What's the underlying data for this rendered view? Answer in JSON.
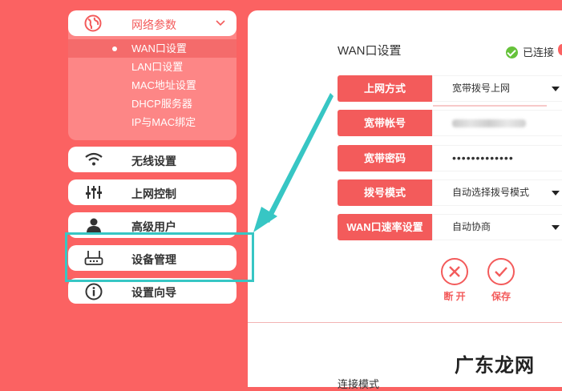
{
  "sidebar": {
    "group": {
      "label": "网络参数",
      "items": [
        {
          "label": "WAN口设置",
          "active": true
        },
        {
          "label": "LAN口设置"
        },
        {
          "label": "MAC地址设置"
        },
        {
          "label": "DHCP服务器"
        },
        {
          "label": "IP与MAC绑定"
        }
      ]
    },
    "menu": [
      {
        "label": "无线设置",
        "icon": "wifi-icon"
      },
      {
        "label": "上网控制",
        "icon": "sliders-icon"
      },
      {
        "label": "高级用户",
        "icon": "user-icon"
      },
      {
        "label": "设备管理",
        "icon": "router-icon"
      },
      {
        "label": "设置向导",
        "icon": "info-icon"
      }
    ]
  },
  "main": {
    "title": "WAN口设置",
    "status": "已连接",
    "fields": [
      {
        "label": "上网方式",
        "value": "宽带拨号上网",
        "type": "select"
      },
      {
        "label": "宽带帐号",
        "value": "",
        "type": "text-blurred"
      },
      {
        "label": "宽带密码",
        "value": "•••••••••••••",
        "type": "password"
      },
      {
        "label": "拨号模式",
        "value": "自动选择拨号模式",
        "type": "select"
      },
      {
        "label": "WAN口速率设置",
        "value": "自动协商",
        "type": "select"
      }
    ],
    "actions": {
      "disconnect": "断 开",
      "save": "保存"
    },
    "bottom_label": "连接模式"
  },
  "watermark": "广东龙网",
  "colors": {
    "accent": "#f35b5b",
    "background": "#fb6262",
    "annotation": "#37c6c4",
    "success": "#66c23a"
  }
}
